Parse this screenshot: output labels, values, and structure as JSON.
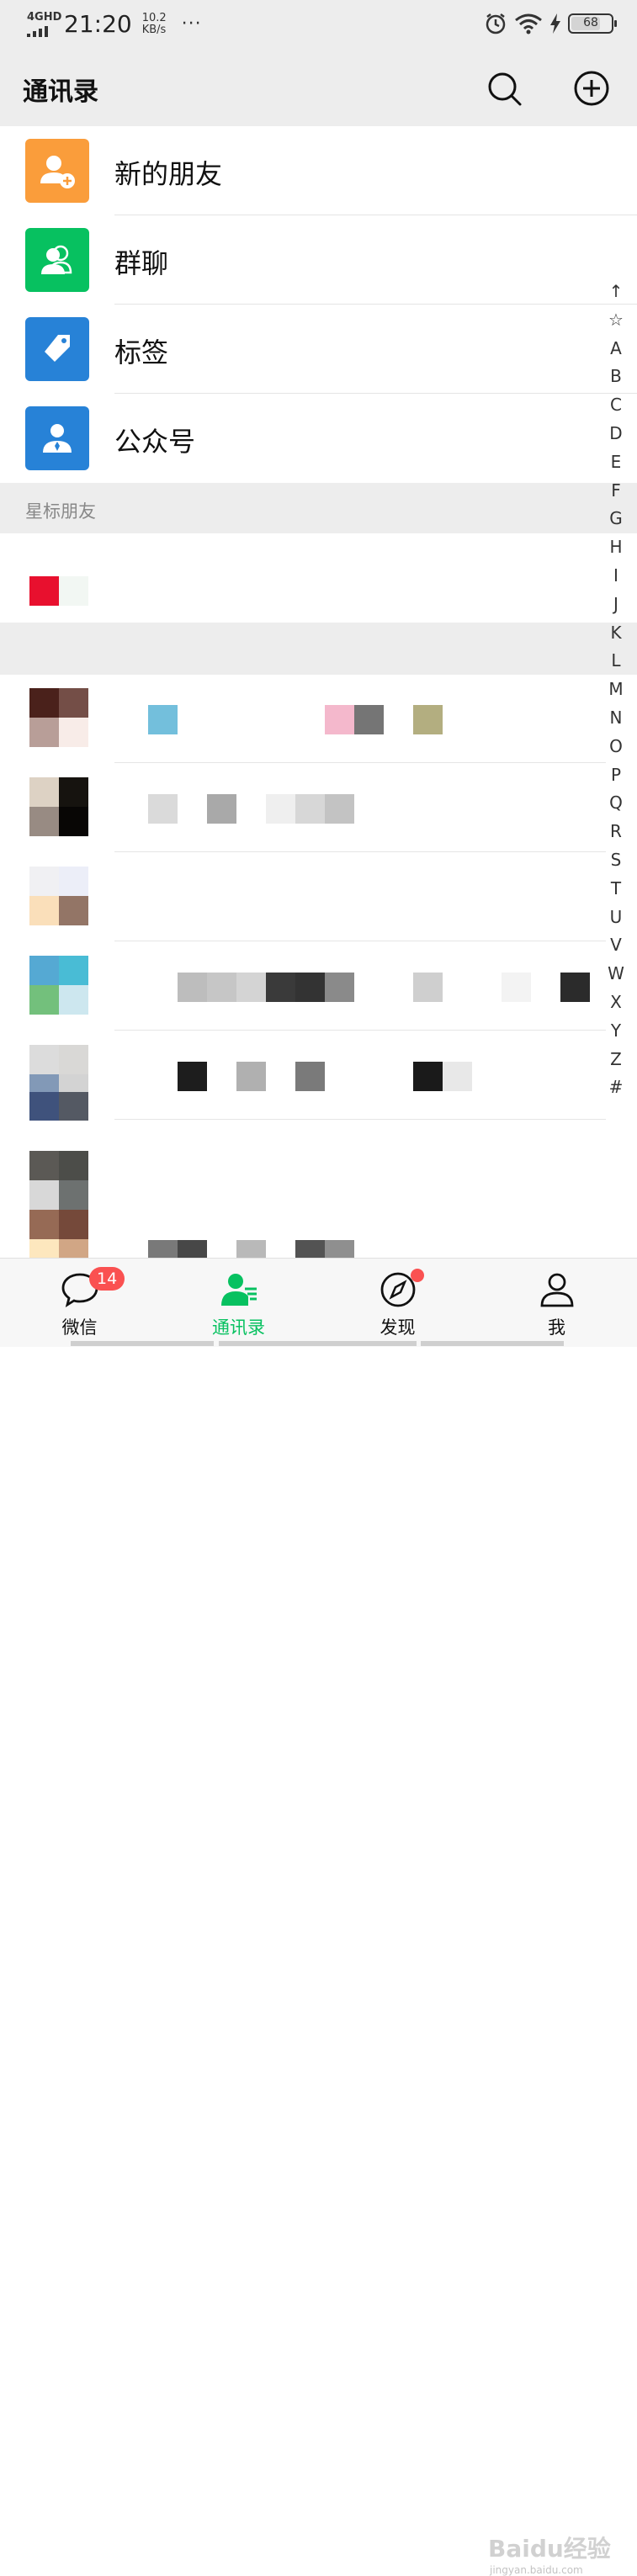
{
  "status_bar": {
    "network": "4GHD",
    "time": "21:20",
    "speed_value": "10.2",
    "speed_unit": "KB/s",
    "more": "···",
    "battery": "68"
  },
  "header": {
    "title": "通讯录",
    "search_icon": "search-icon",
    "add_icon": "plus-circle-icon"
  },
  "features": [
    {
      "label": "新的朋友",
      "icon": "add-friend-icon",
      "color": "#fa9d3b"
    },
    {
      "label": "群聊",
      "icon": "group-chat-icon",
      "color": "#07c160"
    },
    {
      "label": "标签",
      "icon": "tag-icon",
      "color": "#2782d7"
    },
    {
      "label": "公众号",
      "icon": "official-account-icon",
      "color": "#2782d7"
    }
  ],
  "sections": {
    "starred": "星标朋友"
  },
  "index_bar": [
    "↑",
    "☆",
    "A",
    "B",
    "C",
    "D",
    "E",
    "F",
    "G",
    "H",
    "I",
    "J",
    "K",
    "L",
    "M",
    "N",
    "O",
    "P",
    "Q",
    "R",
    "S",
    "T",
    "U",
    "V",
    "W",
    "X",
    "Y",
    "Z",
    "#"
  ],
  "tabs": [
    {
      "label": "微信",
      "icon": "chat-bubble-icon",
      "badge": "14",
      "active": false
    },
    {
      "label": "通讯录",
      "icon": "contacts-icon",
      "active": true
    },
    {
      "label": "发现",
      "icon": "compass-icon",
      "dot": true,
      "active": false
    },
    {
      "label": "我",
      "icon": "person-icon",
      "active": false
    }
  ],
  "colors": {
    "accent": "#07c160",
    "badge": "#fa5151",
    "header_bg": "#ededed"
  },
  "watermark": {
    "text": "Baidu经验",
    "sub": "jingyan.baidu.com"
  }
}
